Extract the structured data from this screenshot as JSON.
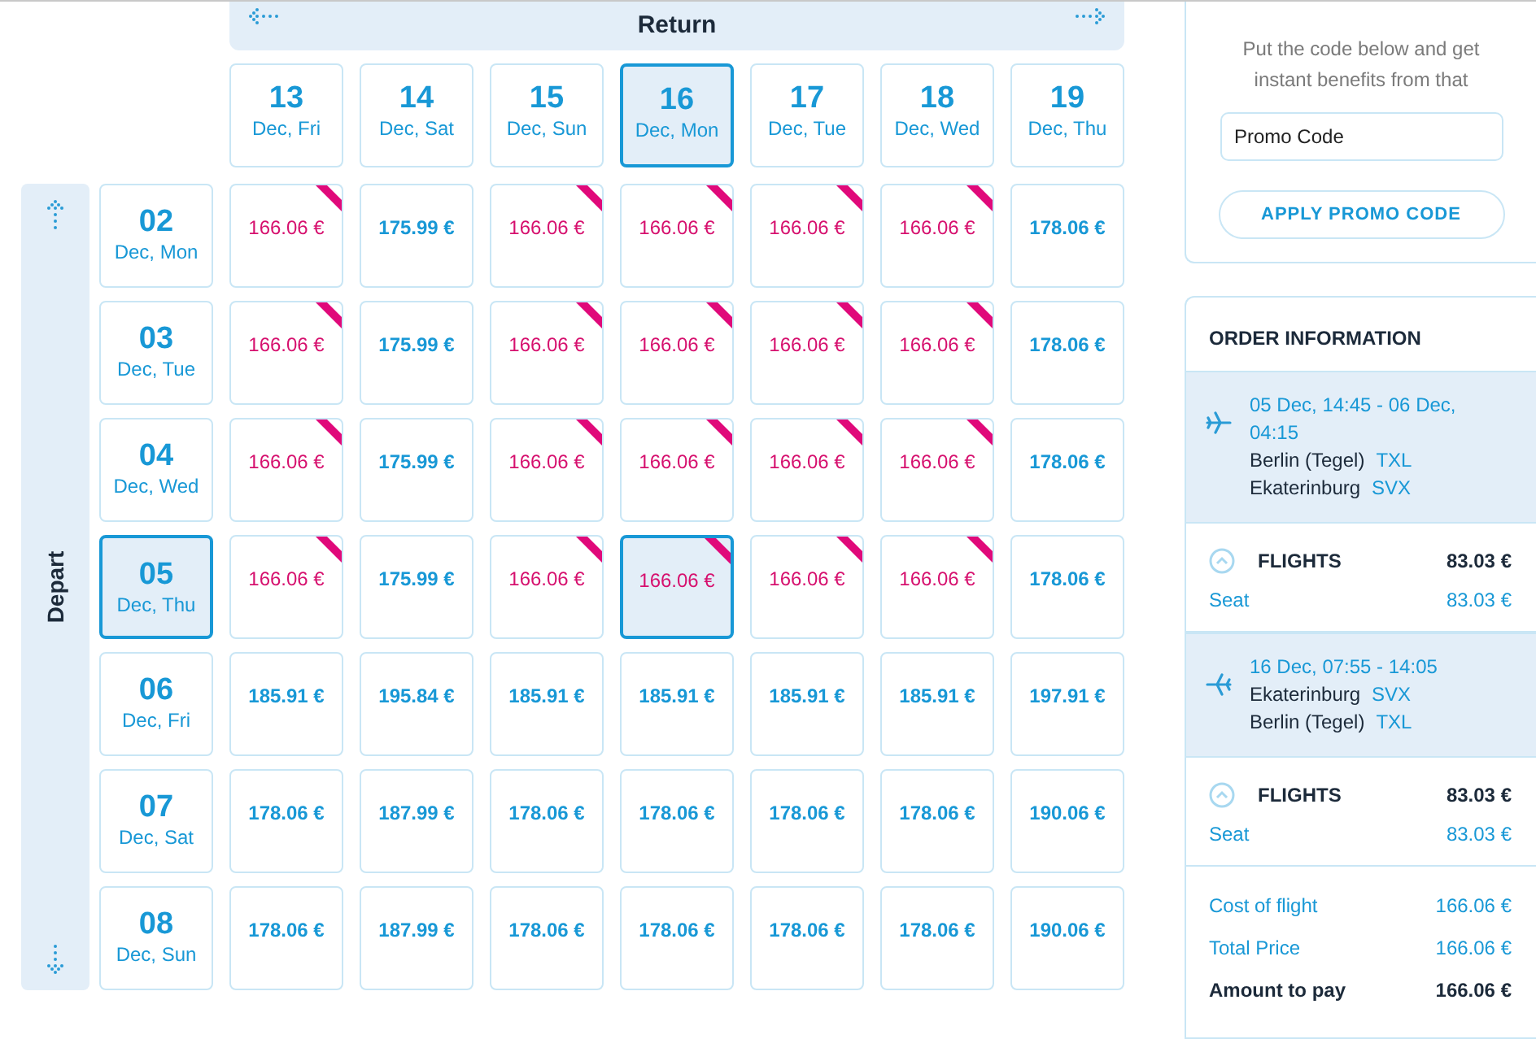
{
  "return_header": {
    "title": "Return"
  },
  "depart_header": {
    "title": "Depart"
  },
  "return_dates": [
    {
      "date": "13",
      "day": "Dec, Fri",
      "selected": false
    },
    {
      "date": "14",
      "day": "Dec, Sat",
      "selected": false
    },
    {
      "date": "15",
      "day": "Dec, Sun",
      "selected": false
    },
    {
      "date": "16",
      "day": "Dec, Mon",
      "selected": true
    },
    {
      "date": "17",
      "day": "Dec, Tue",
      "selected": false
    },
    {
      "date": "18",
      "day": "Dec, Wed",
      "selected": false
    },
    {
      "date": "19",
      "day": "Dec, Thu",
      "selected": false
    }
  ],
  "rows": [
    {
      "date": "02",
      "day": "Dec, Mon",
      "selected": false,
      "cells": [
        {
          "price": "166.06 €",
          "deal": true,
          "selected": false
        },
        {
          "price": "175.99 €",
          "deal": false,
          "selected": false
        },
        {
          "price": "166.06 €",
          "deal": true,
          "selected": false
        },
        {
          "price": "166.06 €",
          "deal": true,
          "selected": false
        },
        {
          "price": "166.06 €",
          "deal": true,
          "selected": false
        },
        {
          "price": "166.06 €",
          "deal": true,
          "selected": false
        },
        {
          "price": "178.06 €",
          "deal": false,
          "selected": false
        }
      ]
    },
    {
      "date": "03",
      "day": "Dec, Tue",
      "selected": false,
      "cells": [
        {
          "price": "166.06 €",
          "deal": true,
          "selected": false
        },
        {
          "price": "175.99 €",
          "deal": false,
          "selected": false
        },
        {
          "price": "166.06 €",
          "deal": true,
          "selected": false
        },
        {
          "price": "166.06 €",
          "deal": true,
          "selected": false
        },
        {
          "price": "166.06 €",
          "deal": true,
          "selected": false
        },
        {
          "price": "166.06 €",
          "deal": true,
          "selected": false
        },
        {
          "price": "178.06 €",
          "deal": false,
          "selected": false
        }
      ]
    },
    {
      "date": "04",
      "day": "Dec, Wed",
      "selected": false,
      "cells": [
        {
          "price": "166.06 €",
          "deal": true,
          "selected": false
        },
        {
          "price": "175.99 €",
          "deal": false,
          "selected": false
        },
        {
          "price": "166.06 €",
          "deal": true,
          "selected": false
        },
        {
          "price": "166.06 €",
          "deal": true,
          "selected": false
        },
        {
          "price": "166.06 €",
          "deal": true,
          "selected": false
        },
        {
          "price": "166.06 €",
          "deal": true,
          "selected": false
        },
        {
          "price": "178.06 €",
          "deal": false,
          "selected": false
        }
      ]
    },
    {
      "date": "05",
      "day": "Dec, Thu",
      "selected": true,
      "cells": [
        {
          "price": "166.06 €",
          "deal": true,
          "selected": false
        },
        {
          "price": "175.99 €",
          "deal": false,
          "selected": false
        },
        {
          "price": "166.06 €",
          "deal": true,
          "selected": false
        },
        {
          "price": "166.06 €",
          "deal": true,
          "selected": true
        },
        {
          "price": "166.06 €",
          "deal": true,
          "selected": false
        },
        {
          "price": "166.06 €",
          "deal": true,
          "selected": false
        },
        {
          "price": "178.06 €",
          "deal": false,
          "selected": false
        }
      ]
    },
    {
      "date": "06",
      "day": "Dec, Fri",
      "selected": false,
      "cells": [
        {
          "price": "185.91 €",
          "deal": false,
          "selected": false
        },
        {
          "price": "195.84 €",
          "deal": false,
          "selected": false
        },
        {
          "price": "185.91 €",
          "deal": false,
          "selected": false
        },
        {
          "price": "185.91 €",
          "deal": false,
          "selected": false
        },
        {
          "price": "185.91 €",
          "deal": false,
          "selected": false
        },
        {
          "price": "185.91 €",
          "deal": false,
          "selected": false
        },
        {
          "price": "197.91 €",
          "deal": false,
          "selected": false
        }
      ]
    },
    {
      "date": "07",
      "day": "Dec, Sat",
      "selected": false,
      "cells": [
        {
          "price": "178.06 €",
          "deal": false,
          "selected": false
        },
        {
          "price": "187.99 €",
          "deal": false,
          "selected": false
        },
        {
          "price": "178.06 €",
          "deal": false,
          "selected": false
        },
        {
          "price": "178.06 €",
          "deal": false,
          "selected": false
        },
        {
          "price": "178.06 €",
          "deal": false,
          "selected": false
        },
        {
          "price": "178.06 €",
          "deal": false,
          "selected": false
        },
        {
          "price": "190.06 €",
          "deal": false,
          "selected": false
        }
      ]
    },
    {
      "date": "08",
      "day": "Dec, Sun",
      "selected": false,
      "cells": [
        {
          "price": "178.06 €",
          "deal": false,
          "selected": false
        },
        {
          "price": "187.99 €",
          "deal": false,
          "selected": false
        },
        {
          "price": "178.06 €",
          "deal": false,
          "selected": false
        },
        {
          "price": "178.06 €",
          "deal": false,
          "selected": false
        },
        {
          "price": "178.06 €",
          "deal": false,
          "selected": false
        },
        {
          "price": "178.06 €",
          "deal": false,
          "selected": false
        },
        {
          "price": "190.06 €",
          "deal": false,
          "selected": false
        }
      ]
    }
  ],
  "coupons": {
    "text": "Put the code below and get instant benefits from that",
    "field": {
      "placeholder": "Promo Code"
    },
    "button": "APPLY PROMO CODE"
  },
  "order": {
    "title": "ORDER INFORMATION",
    "segments": [
      {
        "time": "05 Dec, 14:45 - 06 Dec, 04:15",
        "from": "Berlin (Tegel)",
        "from_code": "TXL",
        "to": "Ekaterinburg",
        "to_code": "SVX",
        "kind": "outbound",
        "section": "FLIGHTS",
        "section_price": "83.03 €",
        "item": "Seat",
        "item_price": "83.03 €"
      },
      {
        "time": "16 Dec, 07:55 - 14:05",
        "from": "Ekaterinburg",
        "from_code": "SVX",
        "to": "Berlin (Tegel)",
        "to_code": "TXL",
        "kind": "return",
        "section": "FLIGHTS",
        "section_price": "83.03 €",
        "item": "Seat",
        "item_price": "83.03 €"
      }
    ],
    "totals": [
      {
        "label": "Cost of flight",
        "value": "166.06 €",
        "kind": "normal"
      },
      {
        "label": "Total Price",
        "value": "166.06 €",
        "kind": "normal"
      },
      {
        "label": "Amount to pay",
        "value": "166.06 €",
        "kind": "strong"
      }
    ]
  }
}
